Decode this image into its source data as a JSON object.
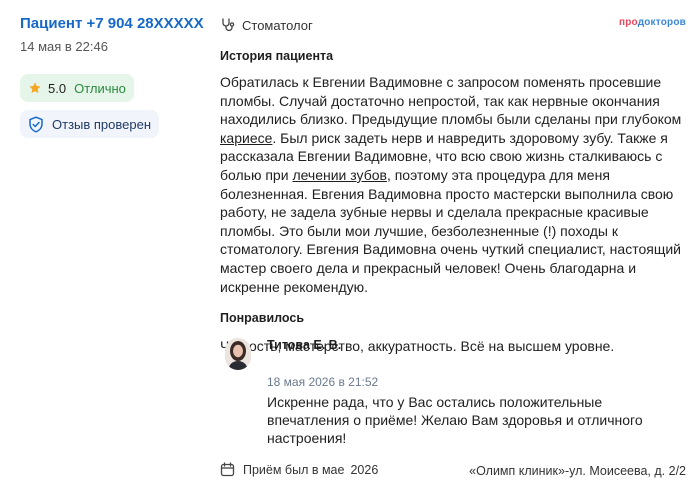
{
  "patient": {
    "name": "Пациент +7 904 28XXXXX",
    "date": "14 мая в 22:46",
    "rating": "5.0",
    "rating_text": "Отлично",
    "verified_text": "Отзыв проверен"
  },
  "header": {
    "specialty": "Стоматолог",
    "brand_pro": "про",
    "brand_doktorov": "докторов"
  },
  "review": {
    "history_title": "История пациента",
    "history": {
      "part1": "Обратилась к Евгении Вадимовне с запросом поменять просевшие пломбы. Случай достаточно непростой, так как нервные окончания находились близко. Предыдущие пломбы были сделаны при глубоком ",
      "link1": "кариесе",
      "part2": ". Был риск задеть нерв и навредить здоровому зубу. Также я рассказала Евгении Вадимовне, что всю свою жизнь сталкиваюсь с болью при ",
      "link2": "лечении зубов",
      "part3": ", поэтому эта процедура для меня болезненная. Евгения Вадимовна просто мастерски выполнила свою работу, не задела зубные нервы и сделала прекрасные красивые пломбы. Это были мои лучшие, безболезненные (!) походы к стоматологу. Евгения Вадимовна очень чуткий специалист, настоящий мастер своего дела и прекрасный человек! Очень благодарна и искренне рекомендую."
    },
    "liked_title": "Понравилось",
    "liked": "Чуткость, мастерство, аккуратность. Всё на высшем уровне."
  },
  "reply": {
    "doctor": "Титова Е. В.",
    "date": "18 мая 2026 в 21:52",
    "text": "Искренне рада, что у Вас остались положительные впечатления о приёме! Желаю Вам здоровья и отличного настроения!"
  },
  "footer": {
    "visit_label": "Приём был в мае",
    "visit_year": "2026",
    "clinic": "«Олимп клиник»-ул. Моисеева, д. 2/2"
  },
  "colors": {
    "link_blue": "#1769c9",
    "badge_green_bg": "#e6f5e9",
    "star_orange": "#f5a623"
  }
}
